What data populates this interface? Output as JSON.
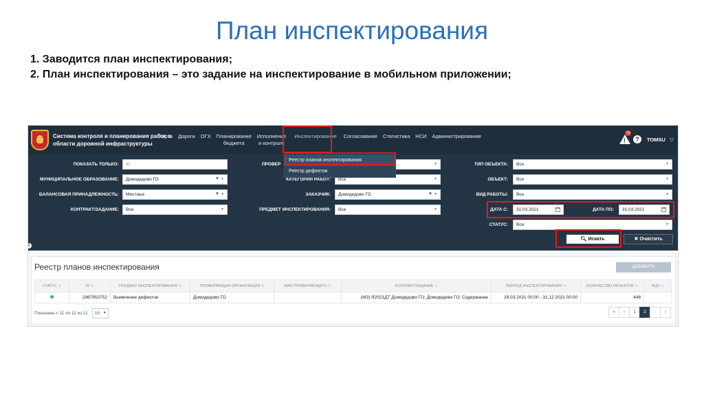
{
  "slide": {
    "title": "План инспектирования",
    "bullets": [
      "1. Заводится план инспектирования;",
      "2. План инспектирования – это задание на инспектирование в мобильном приложении;"
    ]
  },
  "app": {
    "system_title": "Система контроля и планирования работ в области дорожной инфраструктуры",
    "menu": [
      "Карта",
      "Дороги",
      "ОГХ",
      "Планирование\nбюджета",
      "Исполнение\nи контроль",
      "Инспектирование",
      "Согласование",
      "Статистика",
      "НСИ",
      "Администрирование"
    ],
    "notifications_count": "16",
    "user": "TOMSU",
    "dropdown": {
      "items": [
        "Реестр планов инспектирования",
        "Реестр дефектов"
      ]
    },
    "filters": {
      "show_only_label": "ПОКАЗАТЬ ТОЛЬКО:",
      "show_only_placeholder": "ID",
      "municipal_label": "МУНИЦИПАЛЬНОЕ ОБРАЗОВАНИЕ:",
      "municipal_value": "Домодедово ГО",
      "balance_label": "БАЛАНСОВАЯ ПРИНАДЛЕЖНОСТЬ:",
      "balance_value": "Местные",
      "contract_label": "КОНТРАКТ/ЗАДАНИЕ:",
      "contract_value": "Все",
      "checker_label": "ПРОВЕР",
      "work_category_label": "КАТЕГОРИЯ РАБОТ:",
      "work_category_value": "Все",
      "customer_label": "ЗАКАЗЧИК:",
      "customer_value": "Домодедово ГО",
      "subject_label": "ПРЕДМЕТ ИНСПЕКТИРОВАНИЯ:",
      "subject_value": "Все",
      "object_type_label": "ТИП ОБЪЕКТА:",
      "object_type_value": "Все",
      "object_label": "ОБЪЕКТ:",
      "object_value": "Все",
      "work_type_label": "ВИД РАБОТЫ:",
      "work_type_value": "Все",
      "date_from_label": "ДАТА С:",
      "date_from_value": "31.03.2021",
      "date_to_label": "ДАТА ПО:",
      "date_to_value": "31.03.2021",
      "status_label": "СТАТУС:",
      "status_value": "Все",
      "search_button": "Искать",
      "clear_button": "Очистить"
    },
    "registry": {
      "title": "Реестр планов инспектирования",
      "add_button": "ДОБАВИТЬ",
      "columns": [
        "СТАТУС",
        "ID",
        "ПРЕДМЕТ ИНСПЕКТИРОВАНИЯ",
        "ПРОВЕРЯЮЩАЯ ОРГАНИЗАЦИЯ",
        "ФИО ПРОВЕРЯЮЩЕГО",
        "КОНТРАКТ/ЗАДАНИЕ",
        "ПЕРИОД ИНСПЕКТИРОВАНИЯ",
        "КОЛИЧЕСТВО ОБЪЕКТОВ",
        "ЭЦП"
      ],
      "rows": [
        {
          "id": "2967953752",
          "subject": "Выявление дефектов",
          "organization": "Домодедово ГО",
          "inspector": "",
          "contract": "(МЗ) Я2021ДТ Домодедово ГО; Домодедово ГО: Содержание",
          "period": "29.03.2021 00:00 - 31.12.2021 00:00",
          "count": "448",
          "sign": ""
        }
      ],
      "footer_prefix": "Показаны с 11 по 11 из",
      "footer_total": "11",
      "page_size": "10",
      "pager": [
        "«",
        "‹",
        "1",
        "2",
        "›",
        "»"
      ]
    }
  }
}
